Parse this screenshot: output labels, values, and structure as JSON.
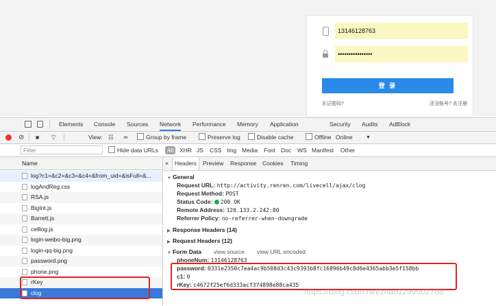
{
  "login": {
    "phone": "13146128763",
    "password": "••••••••••••••••",
    "button": "登 录",
    "forgot": "忘记密码?",
    "no_account": "还没账号? 去注册"
  },
  "devtools": {
    "tabs": [
      "Elements",
      "Console",
      "Sources",
      "Network",
      "Performance",
      "Memory",
      "Application",
      "Security",
      "Audits",
      "AdBlock"
    ],
    "active_tab": "Network",
    "network_toolbar": {
      "view": "View:",
      "group_by_frame": "Group by frame",
      "preserve_log": "Preserve log",
      "disable_cache": "Disable cache",
      "offline": "Offline",
      "online": "Online",
      "dropdown": "▼"
    },
    "filter": {
      "placeholder": "Filter",
      "hide_data_urls": "Hide data URLs",
      "types": [
        "All",
        "XHR",
        "JS",
        "CSS",
        "Img",
        "Media",
        "Font",
        "Doc",
        "WS",
        "Manifest",
        "Other"
      ]
    },
    "requests": {
      "header": "Name",
      "items": [
        "log?c1=&c2=&c3=&c4=&from_uid=&isFull=&...",
        "logAndReg.css",
        "RSA.js",
        "BigInt.js",
        "Barrett.js",
        "celllog.js",
        "login-weibo-big.png",
        "login-qq-big.png",
        "password.png",
        "phone.png",
        "rKey",
        "clog"
      ]
    },
    "detail": {
      "close": "×",
      "tabs": [
        "Headers",
        "Preview",
        "Response",
        "Cookies",
        "Timing"
      ],
      "general": {
        "title": "General",
        "request_url_label": "Request URL:",
        "request_url": "http://activity.renren.com/livecell/ajax/clog",
        "method_label": "Request Method:",
        "method": "POST",
        "status_label": "Status Code:",
        "status": "200 OK",
        "remote_label": "Remote Address:",
        "remote": "120.133.2.242:80",
        "referrer_label": "Referrer Policy:",
        "referrer": "no-referrer-when-downgrade"
      },
      "response_headers": "Response Headers (14)",
      "request_headers": "Request Headers (12)",
      "form_data": {
        "title": "Form Data",
        "view_source": "view source",
        "view_url_encoded": "view URL encoded",
        "phone_label": "phoneNum:",
        "phone": "13146128763",
        "password_label": "password:",
        "password": "0331e2350c7ea4ac9b508d3c43c9393b8fc16896b49c8d6e4365abb3e5f158bb",
        "c1_label": "c1:",
        "c1": "0",
        "rkey_label": "rKey:",
        "rkey": "c4672f25ef6d333acf374898e88ca435"
      }
    }
  },
  "watermark": "https://blog.csdn.net/zhao1299002788"
}
